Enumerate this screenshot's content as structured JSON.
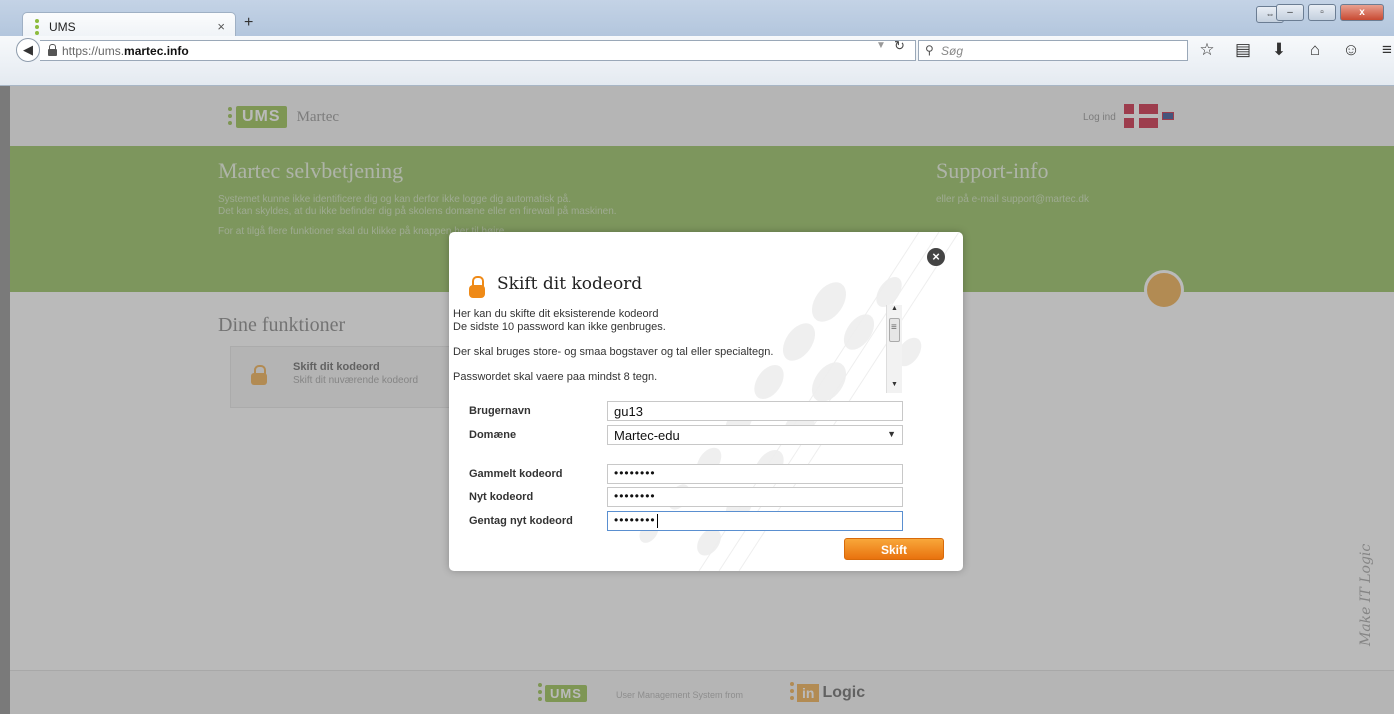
{
  "browser": {
    "tab_title": "UMS",
    "tab_close": "×",
    "new_tab": "+",
    "url_prefix": "https://ums.",
    "url_host": "martec.info",
    "search_placeholder": "Søg"
  },
  "header": {
    "logo_text": "UMS",
    "logo_sub": "Martec",
    "login_link": "Log ind"
  },
  "banner": {
    "title": "Martec selvbetjening",
    "line1": "Systemet kunne ikke identificere dig og kan derfor ikke logge dig automatisk på.",
    "line2": "Det kan skyldes, at du ikke befinder dig på skolens domæne eller en firewall på maskinen.",
    "line3": "For at tilgå flere funktioner skal du klikke på knappen her til højre.",
    "support_title": "Support-info",
    "support_text": "eller på e-mail support@martec.dk"
  },
  "functions": {
    "title": "Dine funktioner",
    "items": [
      {
        "name": "Skift dit kodeord",
        "desc": "Skift dit nuværende kodeord"
      }
    ]
  },
  "modal": {
    "title": "Skift dit kodeord",
    "close": "×",
    "info": [
      "Her kan du skifte dit eksisterende kodeord",
      "De sidste 10 password kan ikke genbruges.",
      "Der skal bruges store- og smaa bogstaver og tal eller specialtegn.",
      "Passwordet skal vaere paa mindst 8 tegn."
    ],
    "username_label": "Brugernavn",
    "username_value": "gu13",
    "domain_label": "Domæne",
    "domain_value": "Martec-edu",
    "old_pw_label": "Gammelt kodeord",
    "old_pw_value": "••••••••",
    "new_pw_label": "Nyt kodeord",
    "new_pw_value": "••••••••",
    "repeat_pw_label": "Gentag nyt kodeord",
    "repeat_pw_value": "••••••••",
    "submit_label": "Skift"
  },
  "footer": {
    "ums": "UMS",
    "text": "User Management System from",
    "in": "in",
    "logic": "Logic"
  },
  "watermark": "Make IT Logic",
  "colors": {
    "accent_green": "#8bbb4e",
    "accent_orange": "#ef8a17"
  }
}
